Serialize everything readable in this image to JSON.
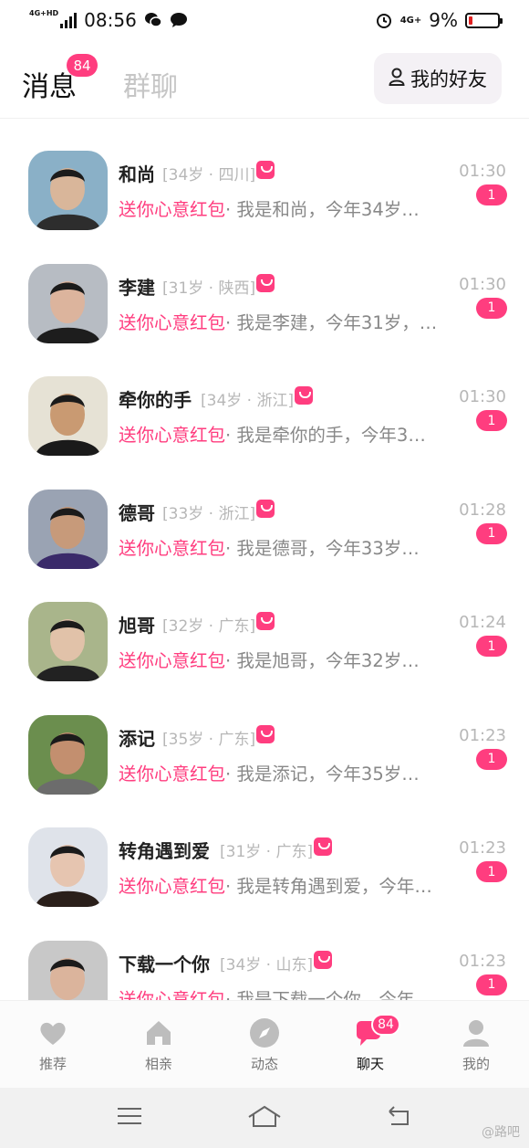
{
  "status_bar": {
    "network": "4G+HD",
    "time": "08:56",
    "network_right": "4G+",
    "battery": "9%"
  },
  "header": {
    "tab_messages": "消息",
    "messages_badge": "84",
    "tab_group": "群聊",
    "friends_button": "我的好友"
  },
  "conversations": [
    {
      "name": "和尚",
      "meta": "[34岁 · 四川]",
      "time": "01:30",
      "gift": "送你心意红包",
      "text": "· 我是和尚，今年34岁…",
      "unread": "1"
    },
    {
      "name": "李建",
      "meta": "[31岁 · 陕西]",
      "time": "01:30",
      "gift": "送你心意红包",
      "text": "· 我是李建，今年31岁，…",
      "unread": "1"
    },
    {
      "name": "牵你的手",
      "meta": "[34岁 · 浙江]",
      "time": "01:30",
      "gift": "送你心意红包",
      "text": "· 我是牵你的手，今年3…",
      "unread": "1"
    },
    {
      "name": "德哥",
      "meta": "[33岁 · 浙江]",
      "time": "01:28",
      "gift": "送你心意红包",
      "text": "· 我是德哥，今年33岁…",
      "unread": "1"
    },
    {
      "name": "旭哥",
      "meta": "[32岁 · 广东]",
      "time": "01:24",
      "gift": "送你心意红包",
      "text": "· 我是旭哥，今年32岁…",
      "unread": "1"
    },
    {
      "name": "添记",
      "meta": "[35岁 · 广东]",
      "time": "01:23",
      "gift": "送你心意红包",
      "text": "· 我是添记，今年35岁…",
      "unread": "1"
    },
    {
      "name": "转角遇到爱",
      "meta": "[31岁 · 广东]",
      "time": "01:23",
      "gift": "送你心意红包",
      "text": "· 我是转角遇到爱，今年…",
      "unread": "1"
    },
    {
      "name": "下载一个你",
      "meta": "[34岁 · 山东]",
      "time": "01:23",
      "gift": "送你心意红包",
      "text": "· 我是下载一个你，今年…",
      "unread": "1"
    }
  ],
  "bottom_nav": [
    {
      "label": "推荐",
      "icon": "heart-icon"
    },
    {
      "label": "相亲",
      "icon": "home-icon"
    },
    {
      "label": "动态",
      "icon": "compass-icon"
    },
    {
      "label": "聊天",
      "icon": "chat-icon",
      "badge": "84"
    },
    {
      "label": "我的",
      "icon": "profile-icon"
    }
  ],
  "system_nav": [
    "menu-icon",
    "home-outline-icon",
    "back-icon"
  ],
  "watermark": "@路吧",
  "colors": {
    "accent": "#ff3d7f",
    "muted": "#b7b7b7"
  }
}
